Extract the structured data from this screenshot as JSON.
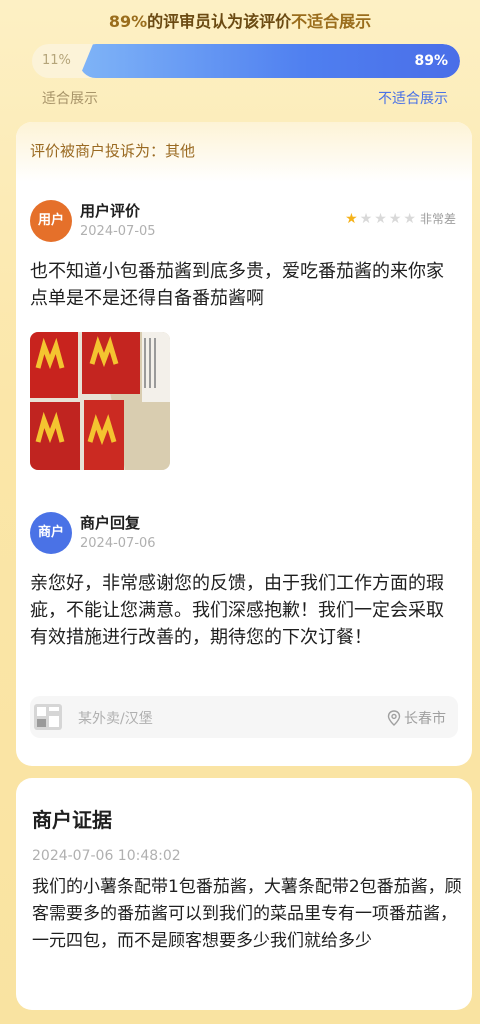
{
  "vote": {
    "headline_percent": "89%",
    "headline_mid": "的评审员认为该评价",
    "headline_verdict": "不适合展示",
    "suitable_percent": "11%",
    "unsuitable_percent": "89%",
    "suitable_fraction": 0.11,
    "unsuitable_fraction": 0.89,
    "suitable_label": "适合展示",
    "unsuitable_label": "不适合展示"
  },
  "complaint": {
    "reason": "评价被商户投诉为：其他"
  },
  "review": {
    "avatar_text": "用户",
    "author": "用户评价",
    "date": "2024-07-05",
    "rating": 1,
    "rating_max": 5,
    "rating_label": "非常差",
    "content": "也不知道小包番茄酱到底多贵，爱吃番茄酱的来你家点单是不是还得自备番茄酱啊"
  },
  "reply": {
    "avatar_text": "商户",
    "author": "商户回复",
    "date": "2024-07-06",
    "content": "亲您好，非常感谢您的反馈，由于我们工作方面的瑕疵，不能让您满意。我们深感抱歉！我们一定会采取有效措施进行改善的，期待您的下次订餐！"
  },
  "shop": {
    "name": "某外卖/汉堡",
    "city": "长春市"
  },
  "evidence": {
    "title": "商户证据",
    "datetime": "2024-07-06 10:48:02",
    "content": "我们的小薯条配带1包番茄酱，大薯条配带2包番茄酱，顾客需要多的番茄酱可以到我们的菜品里专有一项番茄酱，一元四包，而不是顾客想要多少我们就给多少"
  },
  "colors": {
    "accent_blue": "#4a72e6",
    "user_orange": "#e5702a",
    "star_gold": "#f5b21a"
  }
}
